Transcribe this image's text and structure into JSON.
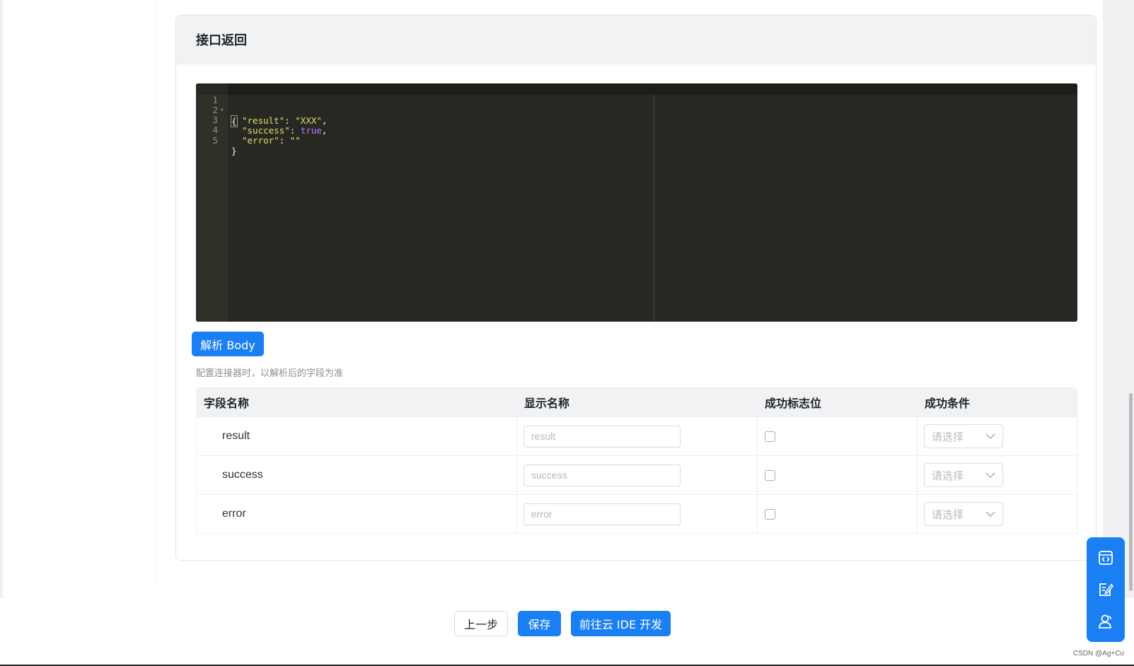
{
  "section": {
    "title": "接口返回"
  },
  "editor": {
    "lines": [
      {
        "num": "1",
        "text": "{"
      },
      {
        "num": "2",
        "key": "\"result\"",
        "colon": ": ",
        "value": "\"XXX\"",
        "tail": ","
      },
      {
        "num": "3",
        "key": "\"success\"",
        "colon": ": ",
        "value": "true",
        "tail": ","
      },
      {
        "num": "4",
        "key": "\"error\"",
        "colon": ": ",
        "value": "\"\"",
        "tail": ""
      },
      {
        "num": "5",
        "text": "}"
      }
    ]
  },
  "parse_button": {
    "label": "解析 Body"
  },
  "hint": "配置连接器时，以解析后的字段为准",
  "table": {
    "headers": [
      "字段名称",
      "显示名称",
      "成功标志位",
      "成功条件"
    ],
    "rows": [
      {
        "field": "result",
        "display_placeholder": "result",
        "select_placeholder": "请选择"
      },
      {
        "field": "success",
        "display_placeholder": "success",
        "select_placeholder": "请选择"
      },
      {
        "field": "error",
        "display_placeholder": "error",
        "select_placeholder": "请选择"
      }
    ]
  },
  "footer": {
    "prev_label": "上一步",
    "save_label": "保存",
    "ide_label": "前往云 IDE 开发"
  },
  "float_toolbar": {
    "icons": [
      "code-window-icon",
      "edit-note-icon",
      "user-group-icon"
    ]
  },
  "watermark": "CSDN @Ag+Cu",
  "colors": {
    "primary": "#1a7ff2",
    "editor_bg": "#272822"
  }
}
